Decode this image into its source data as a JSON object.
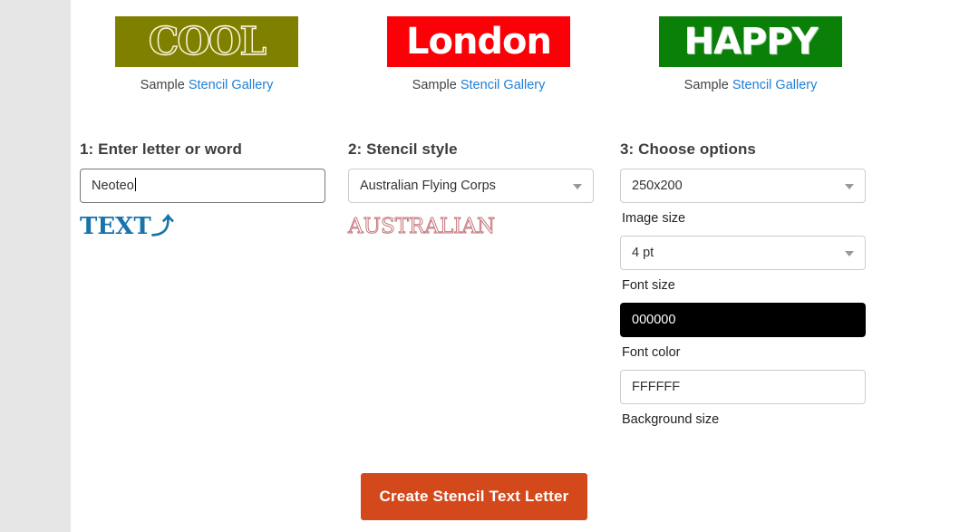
{
  "samples": [
    {
      "word": "COOL",
      "bg_color": "#808000",
      "style": "outline-serif",
      "caption_static": "Sample",
      "caption_link": "Stencil Gallery"
    },
    {
      "word": "London",
      "bg_color": "#FB0007",
      "style": "solid-white",
      "caption_static": "Sample",
      "caption_link": "Stencil Gallery"
    },
    {
      "word": "HAPPY",
      "bg_color": "#0B8009",
      "style": "solid-white-bold",
      "caption_static": "Sample",
      "caption_link": "Stencil Gallery"
    }
  ],
  "step1": {
    "title": "1: Enter letter or word",
    "input_value": "Neoteo",
    "input_placeholder": "Enter letter or word",
    "preview_word": "TEXT",
    "preview_swoosh": "⤴",
    "preview_color": "#1673AB"
  },
  "step2": {
    "title": "2: Stencil style",
    "select_value": "Australian Flying Corps",
    "preview_word": "AUSTRALIAN",
    "preview_color": "#C4757A"
  },
  "step3": {
    "title": "3: Choose options",
    "image_size_value": "250x200",
    "image_size_label": "Image size",
    "font_size_value": "4 pt",
    "font_size_label": "Font size",
    "font_color_value": "000000",
    "font_color_label": "Font color",
    "background_value": "FFFFFF",
    "background_label": "Background size"
  },
  "action": {
    "create_label": "Create Stencil Text Letter",
    "accent_color": "#D4491C"
  }
}
